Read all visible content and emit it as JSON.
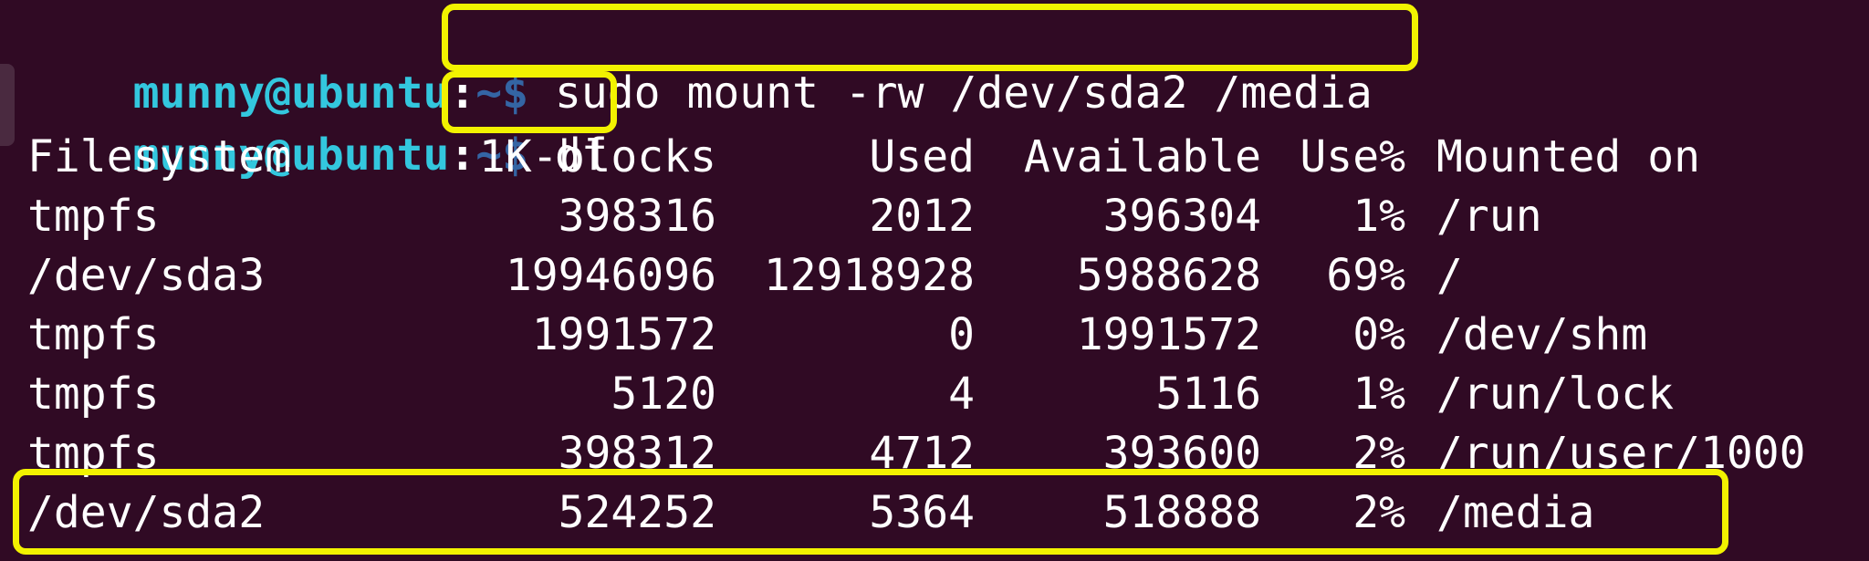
{
  "colors": {
    "background": "#300a24",
    "prompt_user": "#33c7de",
    "prompt_path": "#3465a4",
    "text": "#ffffff",
    "highlight": "#f2f200"
  },
  "prompt": {
    "user_host": "munny@ubuntu",
    "colon": ":",
    "path": "~$"
  },
  "commands": [
    " sudo mount -rw /dev/sda2 /media",
    " df"
  ],
  "df": {
    "headers": [
      "Filesystem",
      "1K-blocks",
      "Used",
      "Available",
      "Use%",
      "Mounted on"
    ],
    "rows": [
      [
        "tmpfs",
        "398316",
        "2012",
        "396304",
        "1%",
        "/run"
      ],
      [
        "/dev/sda3",
        "19946096",
        "12918928",
        "5988628",
        "69%",
        "/"
      ],
      [
        "tmpfs",
        "1991572",
        "0",
        "1991572",
        "0%",
        "/dev/shm"
      ],
      [
        "tmpfs",
        "5120",
        "4",
        "5116",
        "1%",
        "/run/lock"
      ],
      [
        "tmpfs",
        "398312",
        "4712",
        "393600",
        "2%",
        "/run/user/1000"
      ],
      [
        "/dev/sda2",
        "524252",
        "5364",
        "518888",
        "2%",
        "/media"
      ]
    ]
  }
}
